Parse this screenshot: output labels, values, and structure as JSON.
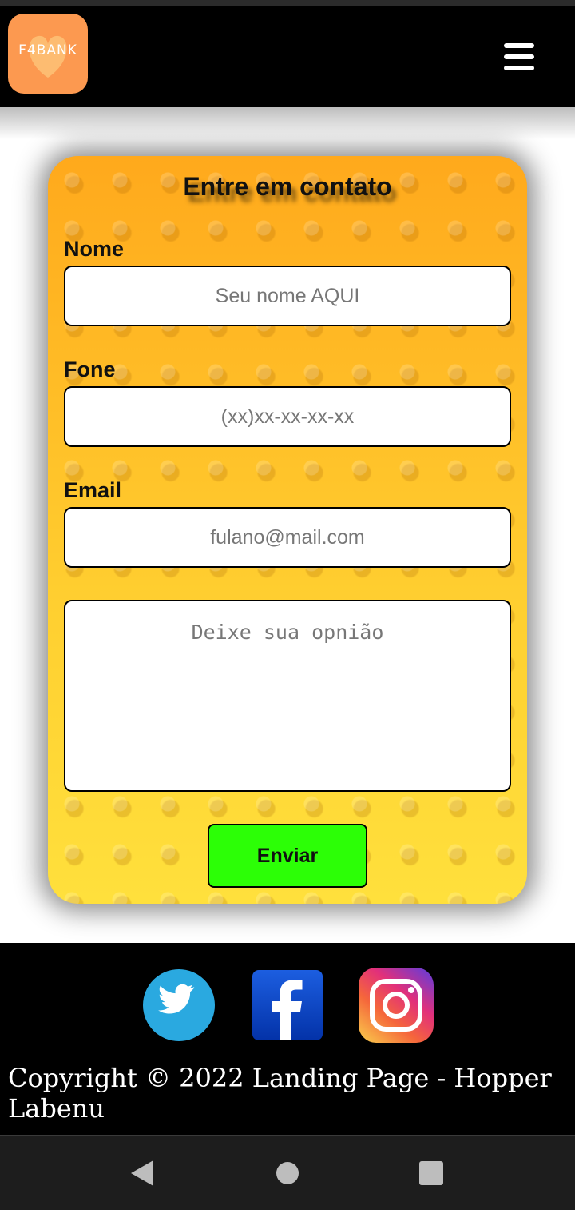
{
  "header": {
    "logo_text": "F4BANK",
    "menu_icon": "hamburger-menu-icon"
  },
  "contact_form": {
    "title": "Entre em contato",
    "name_label": "Nome",
    "name_placeholder": "Seu nome AQUI",
    "phone_label": "Fone",
    "phone_placeholder": "(xx)xx-xx-xx-xx",
    "email_label": "Email",
    "email_placeholder": "fulano@mail.com",
    "message_placeholder": "Deixe sua opnião",
    "submit_label": "Enviar"
  },
  "footer": {
    "social": [
      "twitter-icon",
      "facebook-icon",
      "instagram-icon"
    ],
    "copyright": "Copyright © 2022 Landing Page - Hopper Labenu"
  },
  "system_nav": [
    "back-icon",
    "home-icon",
    "recents-icon"
  ],
  "colors": {
    "header_bg": "#000000",
    "logo_bg": "#fc9950",
    "card_gradient_top": "#ffa91c",
    "card_gradient_bottom": "#ffe03c",
    "submit_bg": "#2cff06",
    "twitter": "#2aa9e0",
    "facebook": "#0a3fb8"
  }
}
